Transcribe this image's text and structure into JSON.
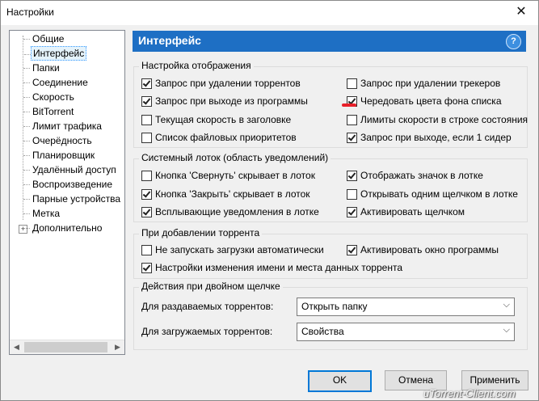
{
  "window": {
    "title": "Настройки",
    "close": "✕"
  },
  "sidebar": {
    "items": [
      {
        "label": "Общие"
      },
      {
        "label": "Интерфейс",
        "selected": true
      },
      {
        "label": "Папки"
      },
      {
        "label": "Соединение"
      },
      {
        "label": "Скорость"
      },
      {
        "label": "BitTorrent"
      },
      {
        "label": "Лимит трафика"
      },
      {
        "label": "Очерёдность"
      },
      {
        "label": "Планировщик"
      },
      {
        "label": "Удалённый доступ"
      },
      {
        "label": "Воспроизведение"
      },
      {
        "label": "Парные устройства"
      },
      {
        "label": "Метка"
      },
      {
        "label": "Дополнительно",
        "expandable": true
      }
    ],
    "scroll_left": "◀",
    "scroll_right": "▶",
    "expander": "+"
  },
  "header": {
    "title": "Интерфейс",
    "help": "?",
    "color": "#1e6fc4"
  },
  "display_group": {
    "title": "Настройка отображения",
    "options": [
      {
        "label": "Запрос при удалении торрентов",
        "checked": true
      },
      {
        "label": "Запрос при удалении трекеров",
        "checked": false
      },
      {
        "label": "Запрос при выходе из программы",
        "checked": true
      },
      {
        "label": "Чередовать цвета фона списка",
        "checked": true
      },
      {
        "label": "Текущая скорость в заголовке",
        "checked": false
      },
      {
        "label": "Лимиты скорости в строке состояния",
        "checked": false
      },
      {
        "label": "Список файловых приоритетов",
        "checked": false
      },
      {
        "label": "Запрос при выходе, если 1 сидер",
        "checked": true
      }
    ]
  },
  "tray_group": {
    "title": "Системный лоток (область уведомлений)",
    "options": [
      {
        "label": "Кнопка 'Свернуть' скрывает в лоток",
        "checked": false
      },
      {
        "label": "Отображать значок в лотке",
        "checked": true
      },
      {
        "label": "Кнопка 'Закрыть' скрывает в лоток",
        "checked": true
      },
      {
        "label": "Открывать одним щелчком в лотке",
        "checked": false
      },
      {
        "label": "Всплывающие уведомления в лотке",
        "checked": true
      },
      {
        "label": "Активировать щелчком",
        "checked": true
      }
    ]
  },
  "add_group": {
    "title": "При добавлении торрента",
    "options": [
      {
        "label": "Не запускать загрузки автоматически",
        "checked": false
      },
      {
        "label": "Активировать окно программы",
        "checked": true
      },
      {
        "label": "Настройки изменения имени и места данных торрента",
        "checked": true
      }
    ]
  },
  "dblclick_group": {
    "title": "Действия при двойном щелчке",
    "seeding_label": "Для раздаваемых торрентов:",
    "seeding_value": "Открыть папку",
    "downloading_label": "Для загружаемых торрентов:",
    "downloading_value": "Свойства",
    "chevron": "⌵"
  },
  "buttons": {
    "ok": "OK",
    "cancel": "Отмена",
    "apply": "Применить"
  },
  "watermark": "uTorrent-Client.com"
}
